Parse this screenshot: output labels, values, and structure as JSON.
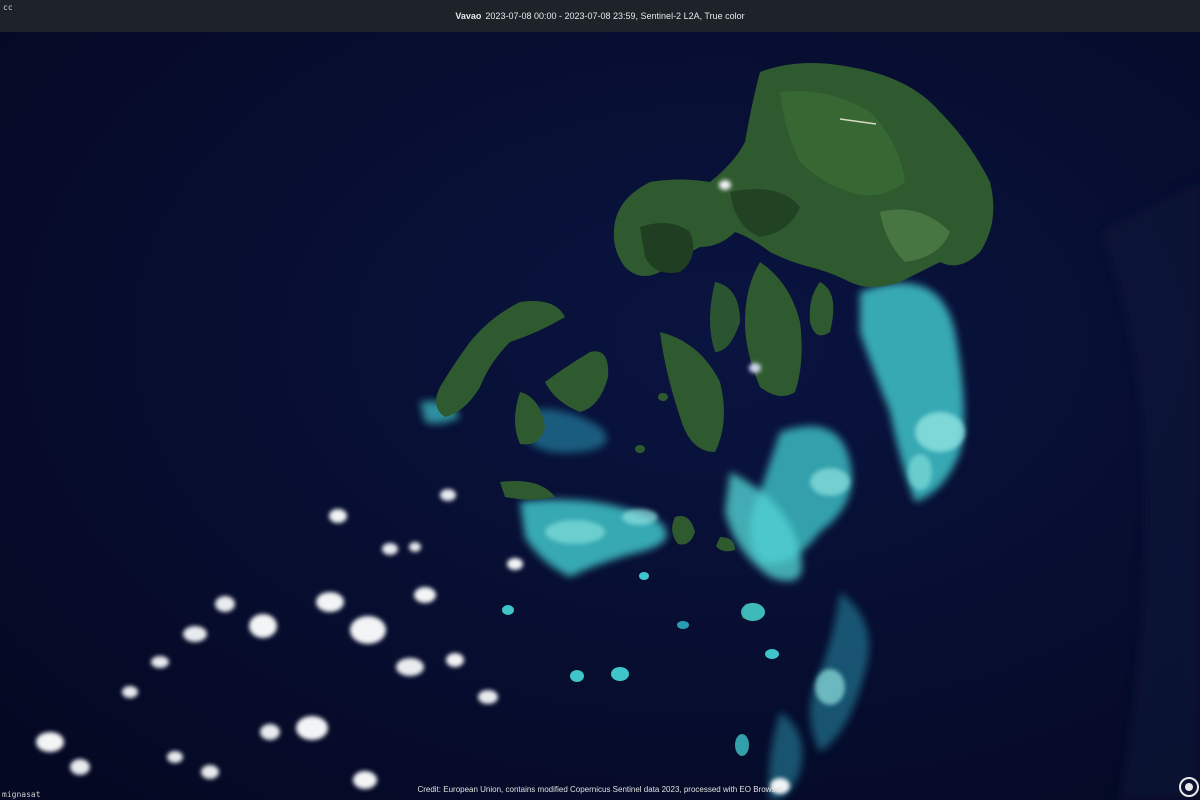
{
  "header": {
    "place": "Vavao",
    "details": "2023-07-08 00:00 - 2023-07-08 23:59, Sentinel-2 L2A, True color"
  },
  "corner_label_top": "cc",
  "corner_label_bottom": "mignasat",
  "footer": {
    "credit": "Credit: European Union, contains modified Copernicus Sentinel data 2023, processed with EO Browser"
  },
  "scene": {
    "subject": "Vava'u island group satellite view",
    "colors": {
      "ocean": "#060c2b",
      "land": "#2f5a2f",
      "land_dark": "#203f22",
      "reef": "#3fc4c9",
      "reef_light": "#8fe3e0",
      "cloud": "#f2f4f6",
      "topbar": "#1e2229"
    }
  },
  "icons": {
    "logo": "eo-browser-logo-icon"
  }
}
